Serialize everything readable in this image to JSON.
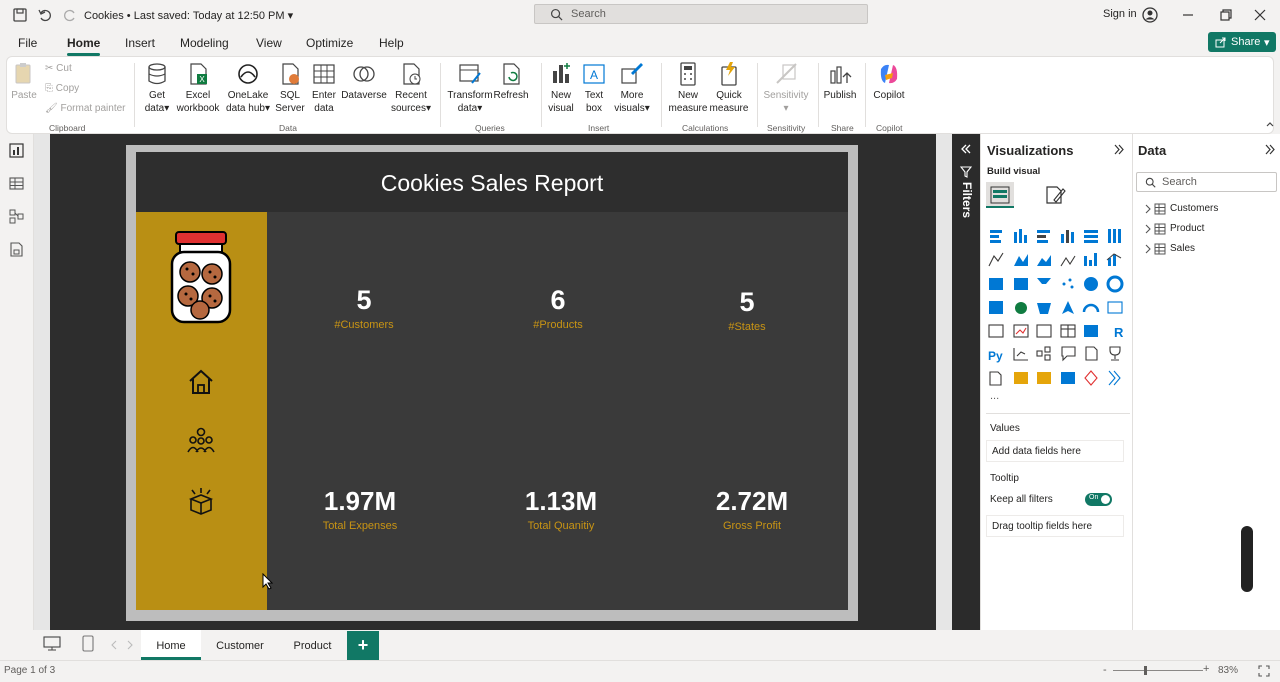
{
  "titlebar": {
    "doc_name": "Cookies",
    "saved": "Last saved: Today at 12:50 PM",
    "search_placeholder": "Search",
    "signin": "Sign in"
  },
  "ribbon_tabs": [
    "File",
    "Home",
    "Insert",
    "Modeling",
    "View",
    "Optimize",
    "Help"
  ],
  "share_label": "Share",
  "clipboard": {
    "paste": "Paste",
    "cut": "Cut",
    "copy": "Copy",
    "format_painter": "Format painter",
    "group": "Clipboard"
  },
  "data_group": {
    "get_data": [
      "Get",
      "data"
    ],
    "excel": [
      "Excel",
      "workbook"
    ],
    "onelake": [
      "OneLake",
      "data hub"
    ],
    "sql": [
      "SQL",
      "Server"
    ],
    "enter": [
      "Enter",
      "data"
    ],
    "dataverse": [
      "Dataverse",
      ""
    ],
    "recent": [
      "Recent",
      "sources"
    ],
    "group": "Data"
  },
  "queries": {
    "transform": [
      "Transform",
      "data"
    ],
    "refresh": [
      "Refresh",
      ""
    ],
    "group": "Queries"
  },
  "insert": {
    "new_visual": [
      "New",
      "visual"
    ],
    "text_box": [
      "Text",
      "box"
    ],
    "more_visuals": [
      "More",
      "visuals"
    ],
    "group": "Insert"
  },
  "calculations": {
    "new_measure": [
      "New",
      "measure"
    ],
    "quick_measure": [
      "Quick",
      "measure"
    ],
    "group": "Calculations"
  },
  "sensitivity": {
    "label": "Sensitivity",
    "group": "Sensitivity"
  },
  "share_group": {
    "publish": "Publish",
    "group": "Share"
  },
  "copilot_group": {
    "copilot": "Copilot",
    "group": "Copilot"
  },
  "report": {
    "title": "Cookies Sales Report",
    "kpis_top": [
      {
        "value": "5",
        "label": "#Customers"
      },
      {
        "value": "6",
        "label": "#Products"
      },
      {
        "value": "5",
        "label": "#States"
      }
    ],
    "kpis_bottom": [
      {
        "value": "1.97M",
        "label": "Total Expenses"
      },
      {
        "value": "1.13M",
        "label": "Total Quanitiy"
      },
      {
        "value": "2.72M",
        "label": "Gross Profit"
      }
    ]
  },
  "filters_label": "Filters",
  "visualizations": {
    "title": "Visualizations",
    "build_visual": "Build visual",
    "values_label": "Values",
    "values_placeholder": "Add data fields here",
    "tooltip_label": "Tooltip",
    "keep_filters": "Keep all filters",
    "toggle_state": "On",
    "tooltip_placeholder": "Drag tooltip fields here",
    "more": "..."
  },
  "data_pane": {
    "title": "Data",
    "search_placeholder": "Search",
    "tables": [
      "Customers",
      "Product",
      "Sales"
    ]
  },
  "pages": [
    "Home",
    "Customer",
    "Product"
  ],
  "add_page": "+",
  "status": {
    "page": "Page 1 of 3",
    "zoom": "83%"
  },
  "colors": {
    "accent": "#117865",
    "gold": "#b98f14",
    "dark": "#3a3a3a"
  }
}
